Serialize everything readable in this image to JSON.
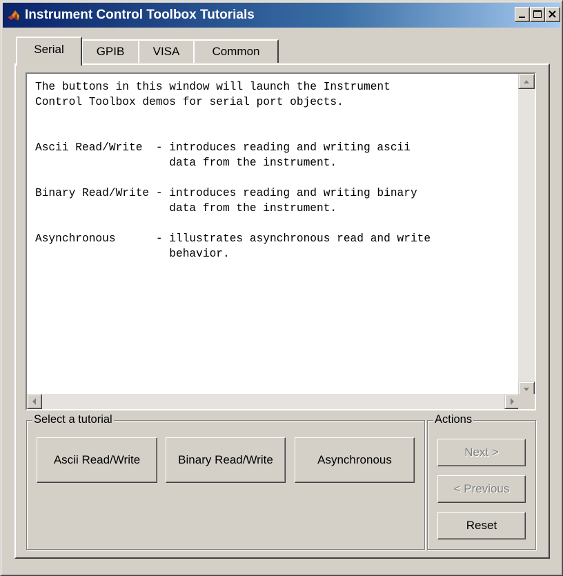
{
  "window": {
    "title": "Instrument Control Toolbox Tutorials",
    "app_icon": "matlab-logo-icon",
    "controls": [
      "minimize-icon",
      "maximize-icon",
      "close-icon"
    ]
  },
  "tabs": [
    {
      "label": "Serial",
      "selected": true
    },
    {
      "label": "GPIB",
      "selected": false
    },
    {
      "label": "VISA",
      "selected": false
    },
    {
      "label": "Common",
      "selected": false
    }
  ],
  "description": {
    "text": "The buttons in this window will launch the Instrument\nControl Toolbox demos for serial port objects.\n\n\nAscii Read/Write  - introduces reading and writing ascii\n                    data from the instrument.\n\nBinary Read/Write - introduces reading and writing binary\n                    data from the instrument.\n\nAsynchronous      - illustrates asynchronous read and write\n                    behavior."
  },
  "select_group": {
    "label": "Select a tutorial",
    "buttons": [
      "Ascii Read/Write",
      "Binary Read/Write",
      "Asynchronous"
    ]
  },
  "actions_group": {
    "label": "Actions",
    "next": "Next >",
    "previous": "< Previous",
    "reset": "Reset",
    "next_enabled": false,
    "previous_enabled": false,
    "reset_enabled": true
  },
  "colors": {
    "title_gradient_start": "#0a246a",
    "title_gradient_end": "#a6caf0",
    "face": "#d4d0c8",
    "disabled_text": "#808080"
  }
}
